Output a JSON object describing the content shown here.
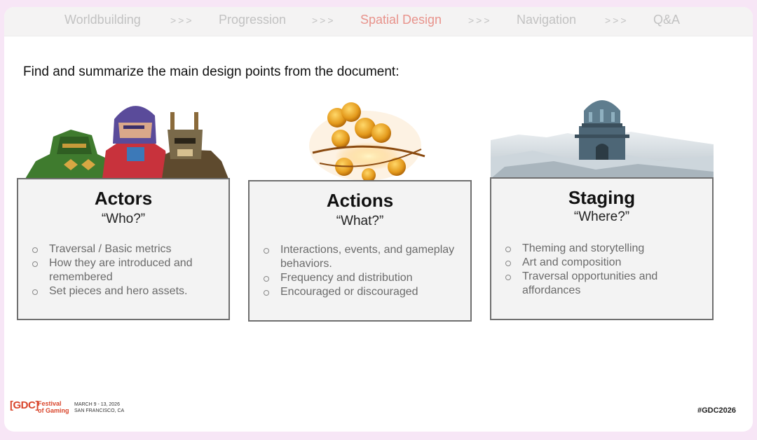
{
  "nav": {
    "items": [
      "Worldbuilding",
      "Progression",
      "Spatial Design",
      "Navigation",
      "Q&A"
    ],
    "separator": ">>>",
    "active_color": "#e8938c",
    "inactive_color": "#c2c2c2"
  },
  "prompt": "Find and summarize the main design points from the document:",
  "cards": [
    {
      "title": "Actors",
      "subtitle": "“Who?”",
      "bullets": [
        "Traversal / Basic metrics",
        "How they are introduced and remembered",
        "Set pieces and hero assets."
      ],
      "art": "character-figures-illustration"
    },
    {
      "title": "Actions",
      "subtitle": "“What?”",
      "bullets": [
        "Interactions, events, and gameplay behaviors.",
        "Frequency and distribution",
        "Encouraged or discouraged"
      ],
      "art": "golden-energy-orbs-illustration"
    },
    {
      "title": "Staging",
      "subtitle": "“Where?”",
      "bullets": [
        "Theming and storytelling",
        "Art and composition",
        "Traversal opportunities and affordances"
      ],
      "art": "snowy-observatory-landscape"
    }
  ],
  "footer": {
    "logo_mark": "[GDC]",
    "logo_line1": "Festival",
    "logo_line2": "of Gaming",
    "dates_line1": "MARCH 9 - 13, 2026",
    "dates_line2": "SAN FRANCISCO, CA",
    "hashtag": "#GDC2026",
    "brand_color": "#d9452b"
  }
}
